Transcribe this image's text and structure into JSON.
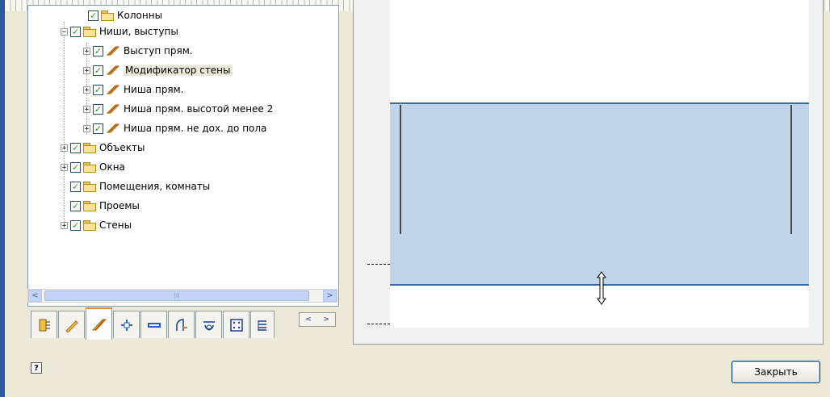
{
  "tree": {
    "items": [
      {
        "label": "Колонны",
        "expander": "none",
        "icon": "folder-icon",
        "checked": true
      },
      {
        "label": "Ниши, выступы",
        "expander": "minus",
        "icon": "folder-icon",
        "checked": true
      },
      {
        "label": "Выступ прям.",
        "expander": "plus",
        "icon": "beam-icon",
        "checked": true
      },
      {
        "label": "Модификатор стены",
        "expander": "plus",
        "icon": "beam-icon",
        "checked": true,
        "selected": true
      },
      {
        "label": "Ниша прям.",
        "expander": "plus",
        "icon": "beam-icon",
        "checked": true
      },
      {
        "label": "Ниша прям. высотой менее 2",
        "expander": "plus",
        "icon": "beam-icon",
        "checked": true
      },
      {
        "label": "Ниша прям. не дох. до пола",
        "expander": "plus",
        "icon": "beam-icon",
        "checked": true
      },
      {
        "label": "Объекты",
        "expander": "plus",
        "icon": "folder-icon",
        "checked": true
      },
      {
        "label": "Окна",
        "expander": "plus",
        "icon": "folder-icon",
        "checked": true
      },
      {
        "label": "Помещения, комнаты",
        "expander": "none",
        "icon": "folder-icon",
        "checked": true
      },
      {
        "label": "Проемы",
        "expander": "none",
        "icon": "folder-icon",
        "checked": true
      },
      {
        "label": "Стены",
        "expander": "plus",
        "icon": "folder-icon",
        "checked": true
      }
    ],
    "scroll_left": "<",
    "scroll_right": ">",
    "scroll_grip": "III"
  },
  "tabs": {
    "icons": [
      "wall-icon",
      "pencil-beam-icon",
      "beam-icon",
      "column-icon",
      "window-icon",
      "door-icon",
      "opening-icon",
      "grid-icon",
      "list-icon"
    ],
    "active_index": 2,
    "scroll_left": "<",
    "scroll_right": ">"
  },
  "preview": {
    "fill_color": "#c0d4ea",
    "line_color": "#3c6aa0"
  },
  "footer": {
    "help_label": "?",
    "close_label": "Закрыть"
  },
  "colors": {
    "check": "#21a121",
    "selection": "#ece9d8",
    "active_tab": "#e68b2c"
  }
}
